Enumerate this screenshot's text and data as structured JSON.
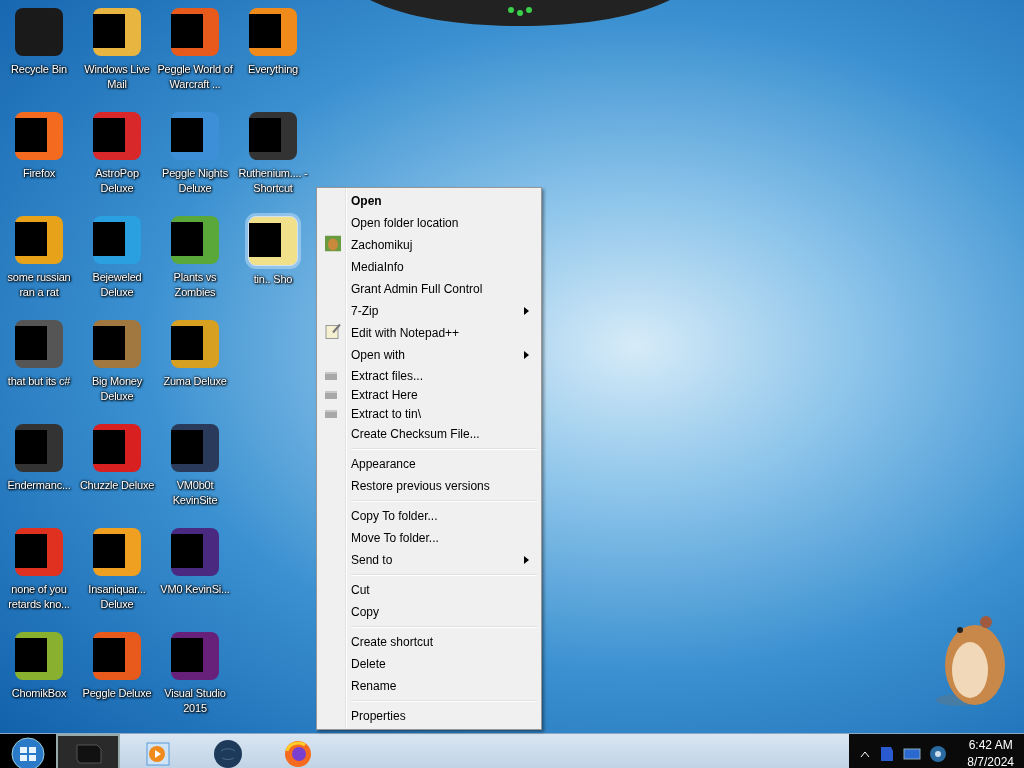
{
  "desktop_columns": [
    [
      {
        "label": "Recycle Bin",
        "color": "#1a1a1a",
        "redacted": false,
        "selected": false
      },
      {
        "label": "Firefox",
        "color": "#f46a1e",
        "redacted": true,
        "selected": false
      },
      {
        "label": "some russian ran a rat",
        "color": "#e8a21a",
        "redacted": true,
        "selected": false
      },
      {
        "label": "that but its c#",
        "color": "#555555",
        "redacted": true,
        "selected": false
      },
      {
        "label": "Endermanc...",
        "color": "#333333",
        "redacted": true,
        "selected": false
      },
      {
        "label": "none of you retards kno...",
        "color": "#e03020",
        "redacted": true,
        "selected": false
      },
      {
        "label": "ChomikBox",
        "color": "#8ab030",
        "redacted": true,
        "selected": false
      }
    ],
    [
      {
        "label": "Windows Live Mail",
        "color": "#e8b640",
        "redacted": true,
        "selected": false
      },
      {
        "label": "AstroPop Deluxe",
        "color": "#d8282a",
        "redacted": true,
        "selected": false
      },
      {
        "label": "Bejeweled Deluxe",
        "color": "#2aa0e0",
        "redacted": true,
        "selected": false
      },
      {
        "label": "Big Money Deluxe",
        "color": "#a07840",
        "redacted": true,
        "selected": false
      },
      {
        "label": "Chuzzle Deluxe",
        "color": "#d82020",
        "redacted": true,
        "selected": false
      },
      {
        "label": "Insaniquar... Deluxe",
        "color": "#f0a020",
        "redacted": true,
        "selected": false
      },
      {
        "label": "Peggle Deluxe",
        "color": "#e85a1c",
        "redacted": true,
        "selected": false
      }
    ],
    [
      {
        "label": "Peggle World of Warcraft ...",
        "color": "#e85a1c",
        "redacted": true,
        "selected": false
      },
      {
        "label": "Peggle Nights Deluxe",
        "color": "#3d8fd8",
        "redacted": true,
        "selected": false
      },
      {
        "label": "Plants vs Zombies",
        "color": "#5aa83a",
        "redacted": true,
        "selected": false
      },
      {
        "label": "Zuma Deluxe",
        "color": "#d8a020",
        "redacted": true,
        "selected": false
      },
      {
        "label": "VM0b0t KevinSite",
        "color": "#2a3a5a",
        "redacted": true,
        "selected": false
      },
      {
        "label": "VM0 KevinSi...",
        "color": "#4a2a80",
        "redacted": true,
        "selected": false
      },
      {
        "label": "Visual Studio 2015",
        "color": "#68217a",
        "redacted": true,
        "selected": false
      }
    ],
    [
      {
        "label": "Everything",
        "color": "#f08a1a",
        "redacted": true,
        "selected": false
      },
      {
        "label": "Ruthenium.... - Shortcut",
        "color": "#333333",
        "redacted": true,
        "selected": false
      },
      {
        "label": "tin.. Sho",
        "color": "#f0e08a",
        "redacted": true,
        "selected": true
      }
    ]
  ],
  "context_menu": {
    "groups": [
      [
        {
          "label": "Open",
          "default": true,
          "submenu": false
        },
        {
          "label": "Open folder location",
          "default": false,
          "submenu": false
        },
        {
          "label": "Zachomikuj",
          "default": false,
          "submenu": false,
          "kind": "picture"
        },
        {
          "label": "MediaInfo",
          "default": false,
          "submenu": false
        },
        {
          "label": "Grant Admin Full Control",
          "default": false,
          "submenu": false
        },
        {
          "label": "7-Zip",
          "default": false,
          "submenu": true
        },
        {
          "label": "Edit with Notepad++",
          "default": false,
          "submenu": false,
          "kind": "notepad"
        },
        {
          "label": "Open with",
          "default": false,
          "submenu": true
        },
        {
          "label": "Extract files...",
          "default": false,
          "submenu": false,
          "kind": "archive"
        },
        {
          "label": "Extract Here",
          "default": false,
          "submenu": false,
          "kind": "archive"
        },
        {
          "label": "Extract to tin\\",
          "default": false,
          "submenu": false,
          "kind": "archive"
        },
        {
          "label": "Create Checksum File...",
          "default": false,
          "submenu": false
        }
      ],
      [
        {
          "label": "Appearance",
          "default": false,
          "submenu": false
        },
        {
          "label": "Restore previous versions",
          "default": false,
          "submenu": false
        }
      ],
      [
        {
          "label": "Copy To folder...",
          "default": false,
          "submenu": false
        },
        {
          "label": "Move To folder...",
          "default": false,
          "submenu": false
        },
        {
          "label": "Send to",
          "default": false,
          "submenu": true
        }
      ],
      [
        {
          "label": "Cut",
          "default": false,
          "submenu": false
        },
        {
          "label": "Copy",
          "default": false,
          "submenu": false
        }
      ],
      [
        {
          "label": "Create shortcut",
          "default": false,
          "submenu": false
        },
        {
          "label": "Delete",
          "default": false,
          "submenu": false
        },
        {
          "label": "Rename",
          "default": false,
          "submenu": false
        }
      ],
      [
        {
          "label": "Properties",
          "default": false,
          "submenu": false
        }
      ]
    ]
  },
  "taskbar": {
    "items": [
      {
        "kind": "window",
        "selected": true
      },
      {
        "kind": "media",
        "selected": false
      },
      {
        "kind": "globe",
        "selected": false
      },
      {
        "kind": "browser",
        "selected": false
      }
    ],
    "clock": {
      "time": "6:42 AM",
      "date": "8/7/2024"
    }
  }
}
